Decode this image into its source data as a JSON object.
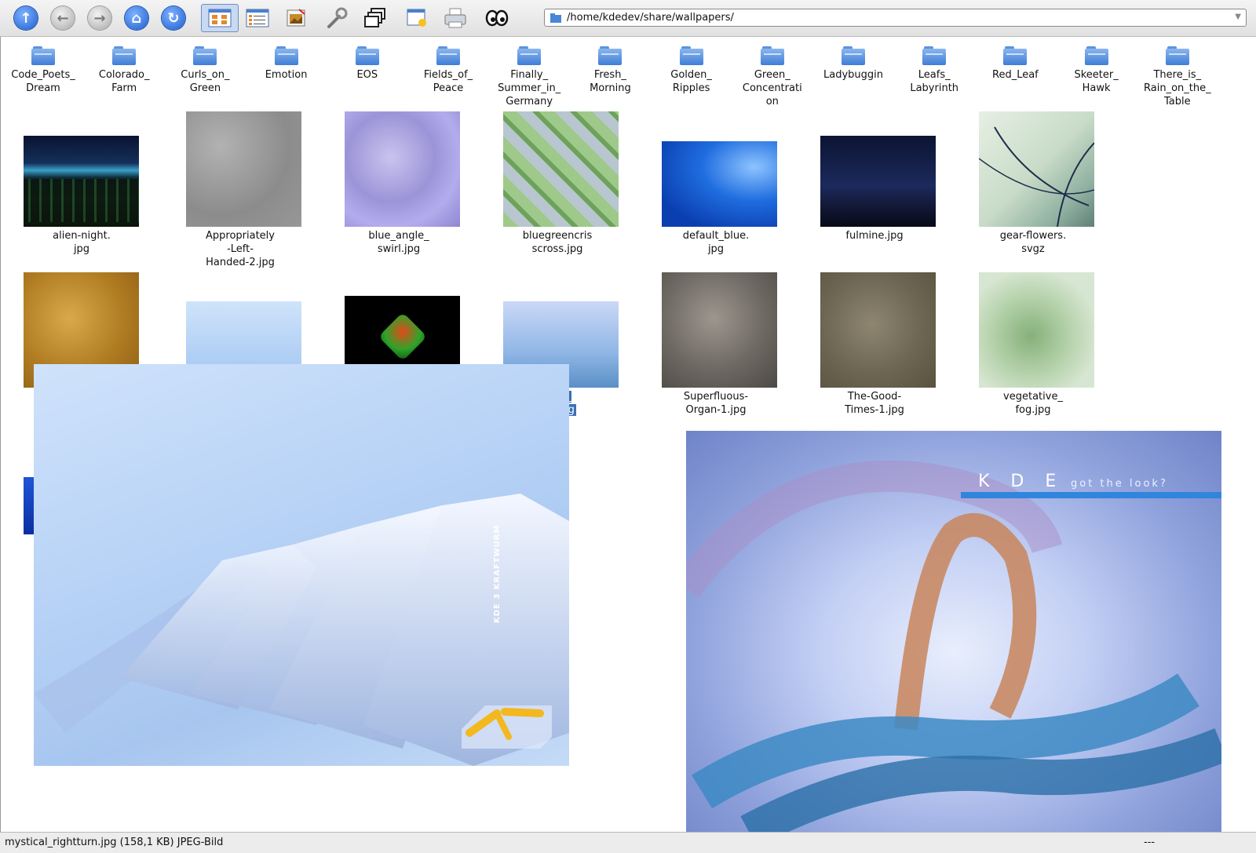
{
  "toolbar": {
    "buttons": [
      {
        "name": "up-icon",
        "glyph": "↑"
      },
      {
        "name": "back-icon",
        "glyph": "←"
      },
      {
        "name": "forward-icon",
        "glyph": "→"
      },
      {
        "name": "home-icon",
        "glyph": "⌂"
      },
      {
        "name": "reload-icon",
        "glyph": "↻"
      },
      {
        "name": "icon-view-icon"
      },
      {
        "name": "detail-view-icon"
      },
      {
        "name": "image-preview-icon"
      },
      {
        "name": "settings-wrench-icon"
      },
      {
        "name": "windows-icon"
      },
      {
        "name": "new-window-icon"
      },
      {
        "name": "print-icon"
      },
      {
        "name": "eyes-icon"
      }
    ],
    "address": "/home/kdedev/share/wallpapers/"
  },
  "folders": [
    "Code_Poets_\nDream",
    "Colorado_\nFarm",
    "Curls_on_\nGreen",
    "Emotion",
    "EOS",
    "Fields_of_\nPeace",
    "Finally_\nSummer_in_\nGermany",
    "Fresh_\nMorning",
    "Golden_\nRipples",
    "Green_\nConcentrati\non",
    "Ladybuggin",
    "Leafs_\nLabyrinth",
    "Red_Leaf",
    "Skeeter_\nHawk",
    "There_is_\nRain_on_the_\nTable"
  ],
  "files_row1": [
    "alien-night.\njpg",
    "Appropriately\n-Left-\nHanded-2.jpg",
    "blue_angle_\nswirl.jpg",
    "bluegreencris\nscross.jpg",
    "default_blue.\njpg",
    "fulmine.jpg",
    "gear-flowers.\nsvgz"
  ],
  "files_row2": [
    "",
    "",
    "",
    "tical_\nurn.jpg",
    "Superfluous-\nOrgan-1.jpg",
    "The-Good-\nTimes-1.jpg",
    "vegetative_\nfog.jpg"
  ],
  "preview_left": {
    "watermark": "KDE 3 KRAFTWURM"
  },
  "preview_right": {
    "title_main": "K D E",
    "title_tag": "got the look?"
  },
  "status": {
    "left": "mystical_rightturn.jpg (158,1 KB)  JPEG-Bild",
    "right": "---"
  },
  "colors": {
    "selection": "#3c6fb5",
    "toolbar_bg": "#e8e8e8"
  }
}
